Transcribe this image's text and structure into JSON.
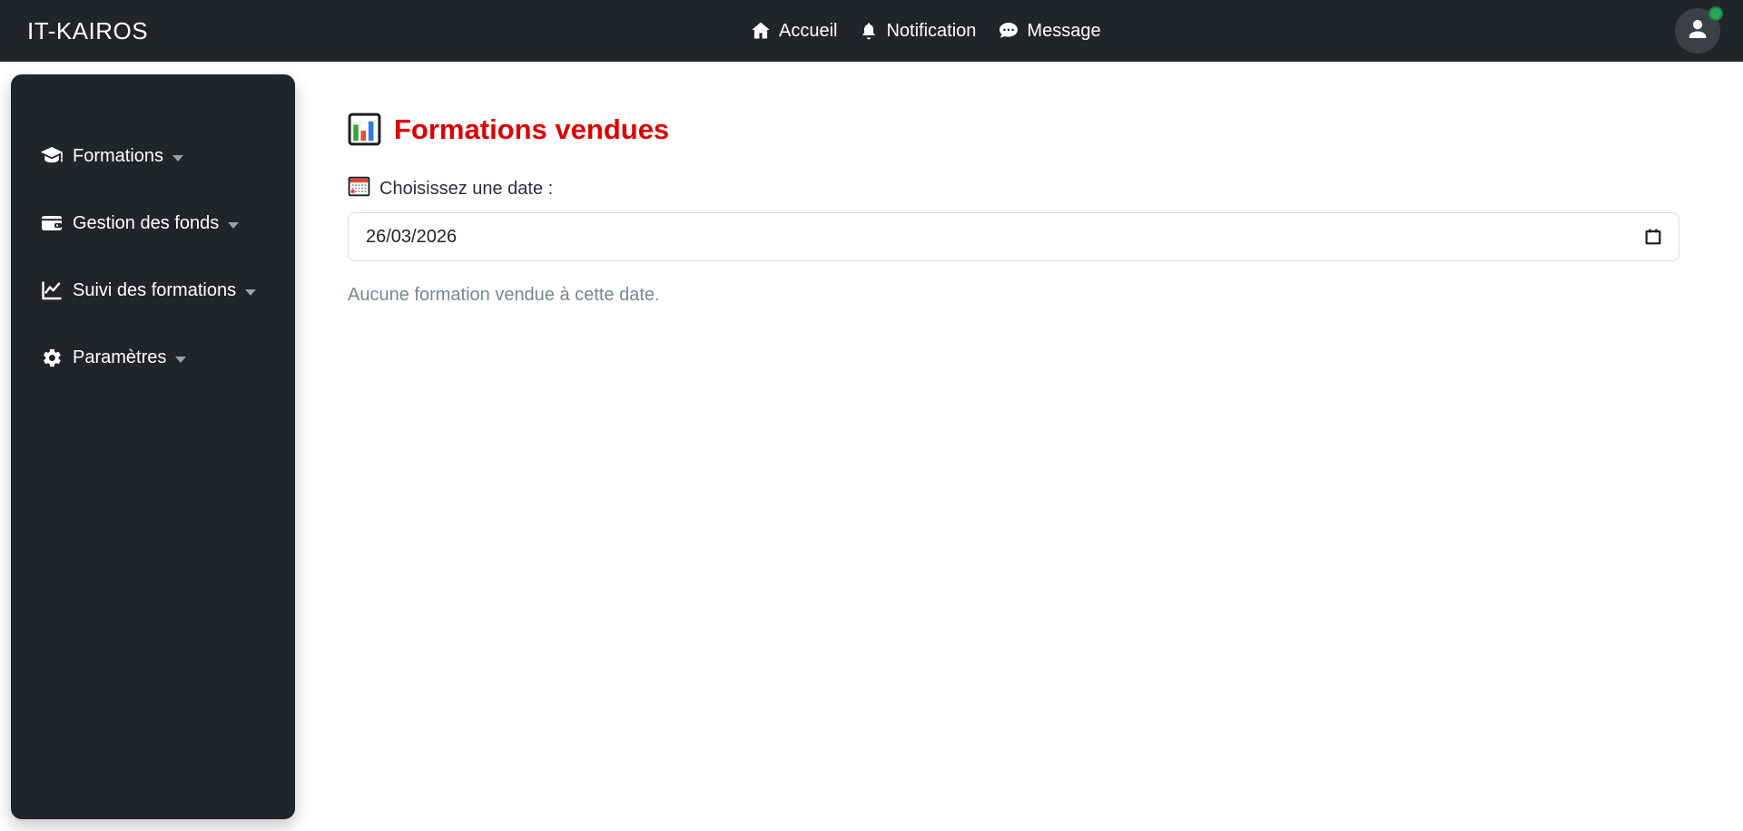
{
  "navbar": {
    "brand": "IT-KAIROS",
    "items": [
      {
        "label": "Accueil",
        "icon": "home-icon"
      },
      {
        "label": "Notification",
        "icon": "bell-icon"
      },
      {
        "label": "Message",
        "icon": "message-icon"
      }
    ],
    "user": {
      "status": "online"
    }
  },
  "sidebar": {
    "items": [
      {
        "label": "Formations",
        "icon": "graduation-cap-icon",
        "expandable": true
      },
      {
        "label": "Gestion des fonds",
        "icon": "wallet-icon",
        "expandable": true
      },
      {
        "label": "Suivi des formations",
        "icon": "chart-line-icon",
        "expandable": true
      },
      {
        "label": "Paramètres",
        "icon": "gear-icon",
        "expandable": true
      }
    ]
  },
  "main": {
    "title": "Formations vendues",
    "title_icon": "bar-chart-icon",
    "date_label": "Choisissez une date :",
    "date_label_icon": "calendar-icon",
    "date_value": "26/03/2026",
    "empty_message": "Aucune formation vendue à cette date."
  },
  "colors": {
    "navbar_bg": "#212529",
    "sidebar_bg": "#212529",
    "title_red": "#dd0000",
    "muted_text": "#7a8691",
    "online_green": "#2aa35b",
    "input_border": "#d9dde1"
  }
}
